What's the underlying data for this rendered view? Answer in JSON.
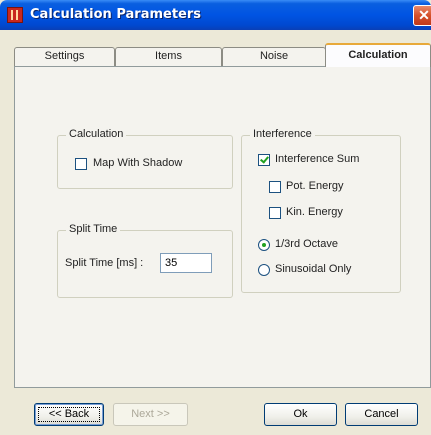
{
  "window": {
    "title": "Calculation Parameters",
    "close_glyph": "✕"
  },
  "tabs": [
    {
      "label": "Settings"
    },
    {
      "label": "Items"
    },
    {
      "label": "Noise"
    },
    {
      "label": "Calculation",
      "active": true
    }
  ],
  "calculation_group": {
    "title": "Calculation",
    "map_with_shadow": {
      "label": "Map With Shadow",
      "checked": false
    }
  },
  "split_time_group": {
    "title": "Split Time",
    "field_label": "Split Time [ms] :",
    "value": "35"
  },
  "interference_group": {
    "title": "Interference",
    "interference_sum": {
      "label": "Interference Sum",
      "checked": true
    },
    "pot_energy": {
      "label": "Pot. Energy",
      "checked": false
    },
    "kin_energy": {
      "label": "Kin. Energy",
      "checked": false
    },
    "third_octave": {
      "label": "1/3rd Octave",
      "selected": true
    },
    "sinusoidal_only": {
      "label": "Sinusoidal Only",
      "selected": false
    }
  },
  "buttons": {
    "back": "<< Back",
    "next": "Next >>",
    "ok": "Ok",
    "cancel": "Cancel"
  }
}
